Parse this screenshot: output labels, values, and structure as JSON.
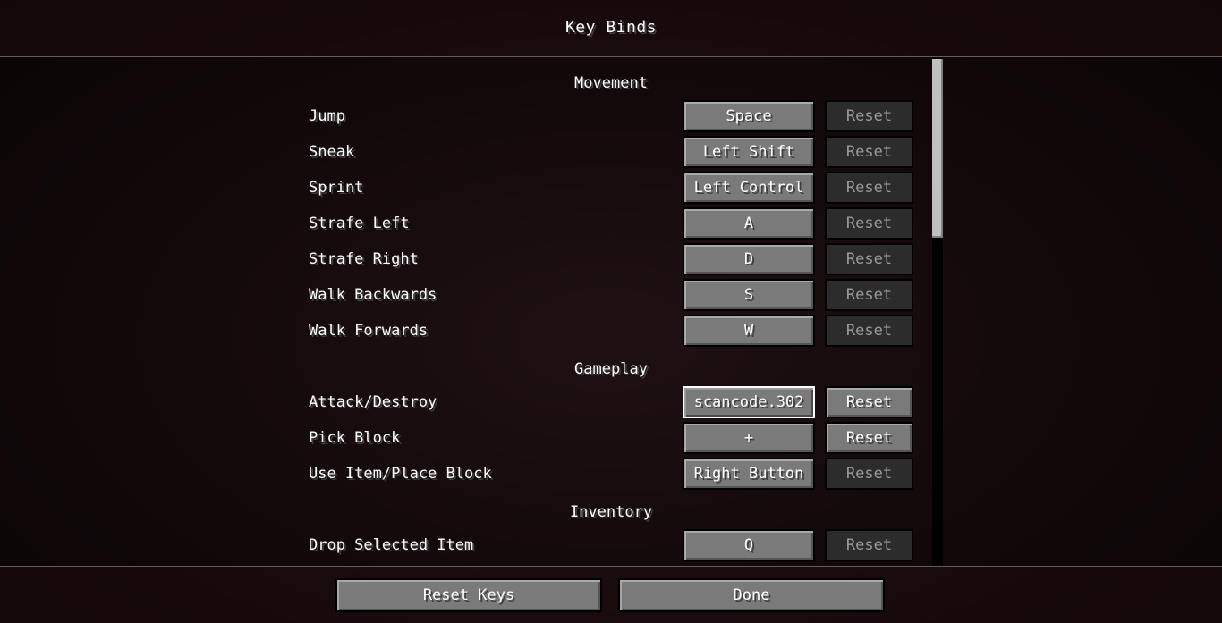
{
  "screen": {
    "title": "Key Binds"
  },
  "sections": {
    "movement": "Movement",
    "gameplay": "Gameplay",
    "inventory": "Inventory"
  },
  "binds": [
    {
      "label": "Jump",
      "key": "Space",
      "reset": "Reset",
      "reset_enabled": false
    },
    {
      "label": "Sneak",
      "key": "Left Shift",
      "reset": "Reset",
      "reset_enabled": false
    },
    {
      "label": "Sprint",
      "key": "Left Control",
      "reset": "Reset",
      "reset_enabled": false
    },
    {
      "label": "Strafe Left",
      "key": "A",
      "reset": "Reset",
      "reset_enabled": false
    },
    {
      "label": "Strafe Right",
      "key": "D",
      "reset": "Reset",
      "reset_enabled": false
    },
    {
      "label": "Walk Backwards",
      "key": "S",
      "reset": "Reset",
      "reset_enabled": false
    },
    {
      "label": "Walk Forwards",
      "key": "W",
      "reset": "Reset",
      "reset_enabled": false
    },
    {
      "label": "Attack/Destroy",
      "key": "scancode.302",
      "reset": "Reset",
      "reset_enabled": true
    },
    {
      "label": "Pick Block",
      "key": "+",
      "reset": "Reset",
      "reset_enabled": true
    },
    {
      "label": "Use Item/Place Block",
      "key": "Right Button",
      "reset": "Reset",
      "reset_enabled": false
    },
    {
      "label": "Drop Selected Item",
      "key": "Q",
      "reset": "Reset",
      "reset_enabled": false
    }
  ],
  "footer": {
    "reset_keys": "Reset Keys",
    "done": "Done"
  }
}
